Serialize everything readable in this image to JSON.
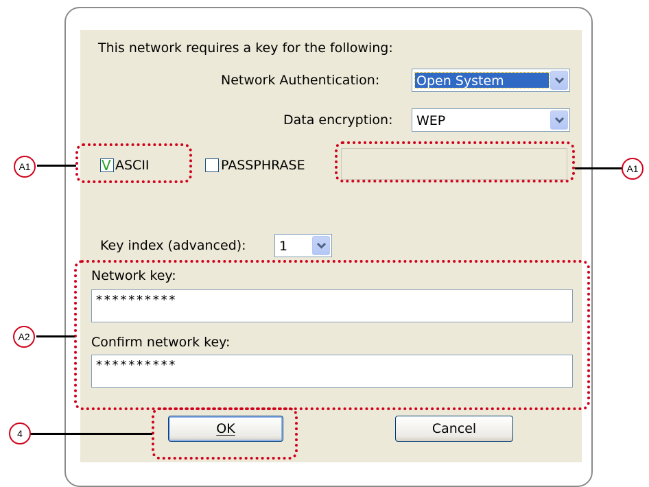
{
  "dialog": {
    "header": "This network requires a key for the following:",
    "auth_label": "Network Authentication:",
    "auth_value": "Open System",
    "enc_label": "Data encryption:",
    "enc_value": "WEP",
    "ascii": {
      "label": "ASCII",
      "checked": true,
      "mark": "V"
    },
    "passphrase": {
      "label": "PASSPHRASE",
      "checked": false,
      "value": ""
    },
    "key_index_label": "Key index (advanced):",
    "key_index_value": "1",
    "network_key_label": "Network key:",
    "network_key_value": "**********",
    "confirm_key_label": "Confirm network key:",
    "confirm_key_value": "**********",
    "ok_label": "OK",
    "cancel_label": "Cancel"
  },
  "callouts": {
    "a1_left": "A1",
    "a1_right": "A1",
    "a2": "A2",
    "four": "4"
  },
  "colors": {
    "annotation": "#d0021b",
    "dialog_bg": "#ece9d8",
    "selection": "#316ac5"
  },
  "icons": [
    "chevron-down-icon",
    "checkmark-icon"
  ]
}
